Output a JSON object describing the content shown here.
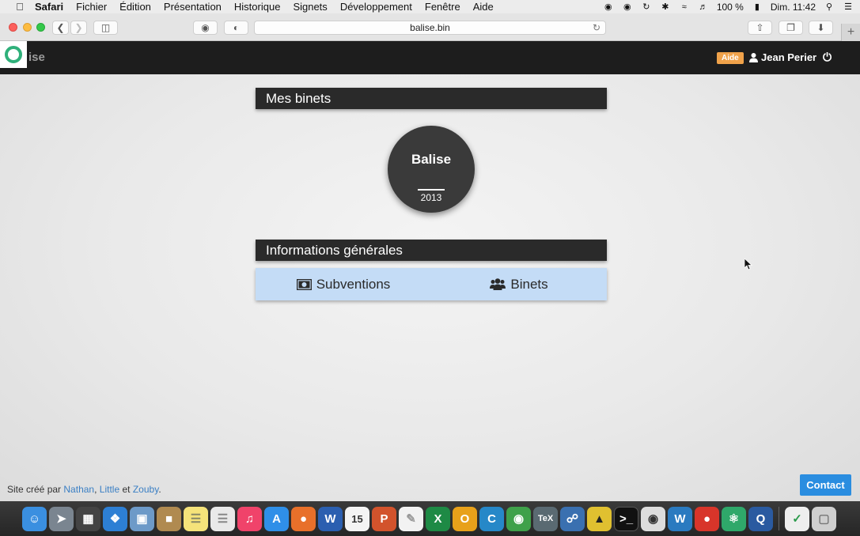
{
  "menubar": {
    "app_name": "Safari",
    "items": [
      "Fichier",
      "Édition",
      "Présentation",
      "Historique",
      "Signets",
      "Développement",
      "Fenêtre",
      "Aide"
    ],
    "battery": "100 %",
    "clock": "Dim. 11:42"
  },
  "toolbar": {
    "url": "balise.bin"
  },
  "navbar": {
    "brand_rest": "ise",
    "help_badge": "Aide",
    "user_name": "Jean Perier"
  },
  "main": {
    "binets_header": "Mes binets",
    "binet": {
      "name": "Balise",
      "year": "2013"
    },
    "info_header": "Informations générales",
    "links": [
      {
        "label": "Subventions",
        "icon": "money-icon"
      },
      {
        "label": "Binets",
        "icon": "users-icon"
      }
    ]
  },
  "footer": {
    "prefix": "Site créé par",
    "author1": "Nathan",
    "sep1": ",",
    "author2": "Little",
    "sep2": "et",
    "author3": "Zouby",
    "suffix": ".",
    "contact_label": "Contact"
  },
  "colors": {
    "navbar_bg": "#1d1d1d",
    "accent_green": "#2fb07a",
    "help_badge": "#f0a24a",
    "link_row_bg": "#c4dcf6",
    "contact_button": "#2a8de0",
    "link_color": "#3a7fc4"
  },
  "dock": {
    "icons": [
      "finder-icon",
      "launchpad-icon",
      "mission-control-icon",
      "safari-icon",
      "preview-icon",
      "contacts-icon",
      "notes-icon",
      "reminders-icon",
      "itunes-icon",
      "app-store-icon",
      "firefox-icon",
      "word-icon",
      "calendar-icon",
      "powerpoint-icon",
      "textedit-icon",
      "excel-icon",
      "onenote-icon",
      "codeblocks-icon",
      "globe-icon",
      "tex-icon",
      "python-icon",
      "pinta-icon",
      "terminal-icon",
      "sequel-pro-icon",
      "mathematica-icon",
      "tomato-icon",
      "atom-icon",
      "quicktime-icon",
      "spreadsheet-icon",
      "trash-icon"
    ],
    "calendar_day": "15"
  }
}
